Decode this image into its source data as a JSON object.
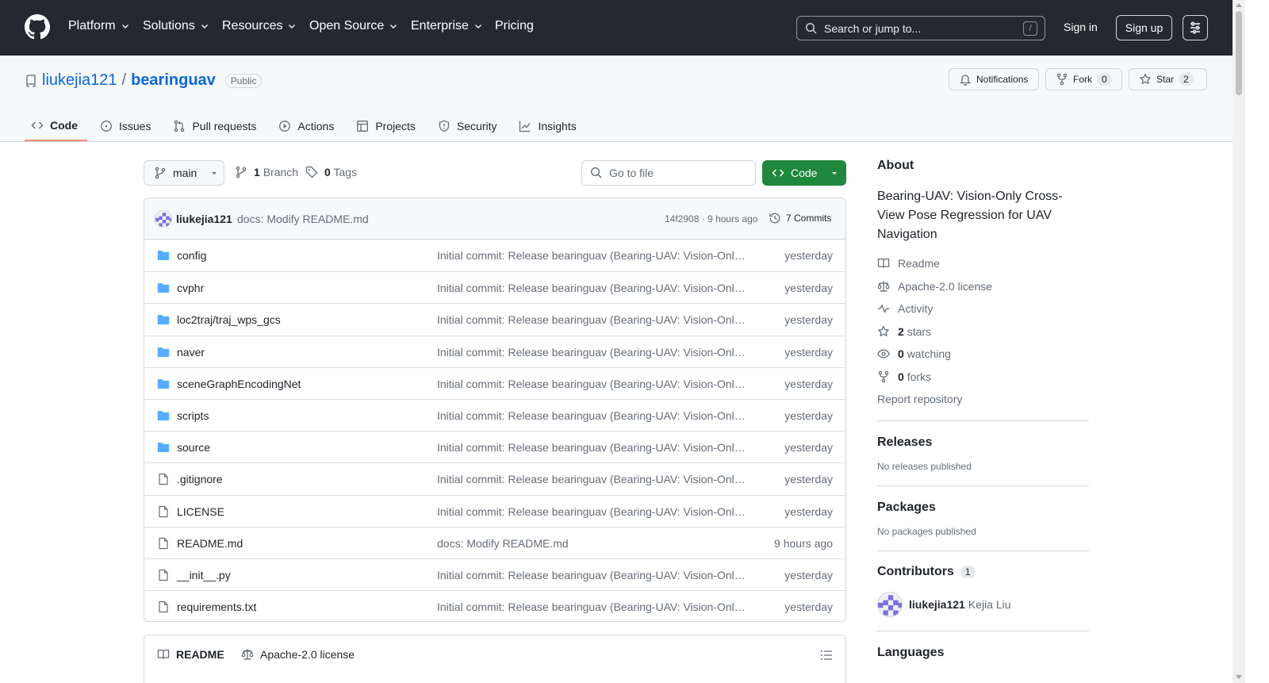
{
  "header": {
    "nav": [
      {
        "label": "Platform",
        "has_menu": true
      },
      {
        "label": "Solutions",
        "has_menu": true
      },
      {
        "label": "Resources",
        "has_menu": true
      },
      {
        "label": "Open Source",
        "has_menu": true
      },
      {
        "label": "Enterprise",
        "has_menu": true
      },
      {
        "label": "Pricing",
        "has_menu": false
      }
    ],
    "search_placeholder": "Search or jump to...",
    "search_shortcut": "/",
    "sign_in": "Sign in",
    "sign_up": "Sign up"
  },
  "repo": {
    "owner": "liukejia121",
    "separator": "/",
    "name": "bearinguav",
    "visibility": "Public",
    "notifications_label": "Notifications",
    "fork_label": "Fork",
    "fork_count": "0",
    "star_label": "Star",
    "star_count": "2",
    "tabs": [
      {
        "label": "Code",
        "icon": "code-icon",
        "active": true
      },
      {
        "label": "Issues",
        "icon": "issue-opened-icon",
        "active": false
      },
      {
        "label": "Pull requests",
        "icon": "git-pull-request-icon",
        "active": false
      },
      {
        "label": "Actions",
        "icon": "play-icon",
        "active": false
      },
      {
        "label": "Projects",
        "icon": "table-icon",
        "active": false
      },
      {
        "label": "Security",
        "icon": "shield-icon",
        "active": false
      },
      {
        "label": "Insights",
        "icon": "graph-icon",
        "active": false
      }
    ]
  },
  "toolbar": {
    "branch": "main",
    "branch_count": "1",
    "branch_label": "Branch",
    "tag_count": "0",
    "tag_label": "Tags",
    "goto_placeholder": "Go to file",
    "code_label": "Code"
  },
  "commit": {
    "author": "liukejia121",
    "message": "docs: Modify README.md",
    "hash": "14f2908",
    "dot": "·",
    "time": "9 hours ago",
    "commits_label": "7 Commits"
  },
  "files": [
    {
      "name": "config",
      "type": "dir",
      "message": "Initial commit: Release bearinguav (Bearing-UAV: Vision-Only Cross-View Pose Regression for UAV Navigation)",
      "time": "yesterday"
    },
    {
      "name": "cvphr",
      "type": "dir",
      "message": "Initial commit: Release bearinguav (Bearing-UAV: Vision-Only Cross-View Pose Regression for UAV Navigation)",
      "time": "yesterday"
    },
    {
      "name": "loc2traj/traj_wps_gcs",
      "type": "dir",
      "message": "Initial commit: Release bearinguav (Bearing-UAV: Vision-Only Cross-View Pose Regression for UAV Navigation)",
      "time": "yesterday"
    },
    {
      "name": "naver",
      "type": "dir",
      "message": "Initial commit: Release bearinguav (Bearing-UAV: Vision-Only Cross-View Pose Regression for UAV Navigation)",
      "time": "yesterday"
    },
    {
      "name": "sceneGraphEncodingNet",
      "type": "dir",
      "message": "Initial commit: Release bearinguav (Bearing-UAV: Vision-Only Cross-View Pose Regression for UAV Navigation)",
      "time": "yesterday"
    },
    {
      "name": "scripts",
      "type": "dir",
      "message": "Initial commit: Release bearinguav (Bearing-UAV: Vision-Only Cross-View Pose Regression for UAV Navigation)",
      "time": "yesterday"
    },
    {
      "name": "source",
      "type": "dir",
      "message": "Initial commit: Release bearinguav (Bearing-UAV: Vision-Only Cross-View Pose Regression for UAV Navigation)",
      "time": "yesterday"
    },
    {
      "name": ".gitignore",
      "type": "file",
      "message": "Initial commit: Release bearinguav (Bearing-UAV: Vision-Only Cross-View Pose Regression for UAV Navigation)",
      "time": "yesterday"
    },
    {
      "name": "LICENSE",
      "type": "file",
      "message": "Initial commit: Release bearinguav (Bearing-UAV: Vision-Only Cross-View Pose Regression for UAV Navigation)",
      "time": "yesterday"
    },
    {
      "name": "README.md",
      "type": "file",
      "message": "docs: Modify README.md",
      "time": "9 hours ago"
    },
    {
      "name": "__init__.py",
      "type": "file",
      "message": "Initial commit: Release bearinguav (Bearing-UAV: Vision-Only Cross-View Pose Regression for UAV Navigation)",
      "time": "yesterday"
    },
    {
      "name": "requirements.txt",
      "type": "file",
      "message": "Initial commit: Release bearinguav (Bearing-UAV: Vision-Only Cross-View Pose Regression for UAV Navigation)",
      "time": "yesterday"
    }
  ],
  "readme_tabs": {
    "readme": "README",
    "license": "Apache-2.0 license"
  },
  "about": {
    "title": "About",
    "description": "Bearing-UAV: Vision-Only Cross-View Pose Regression for UAV Navigation",
    "readme": "Readme",
    "license": "Apache-2.0 license",
    "activity": "Activity",
    "stars_count": "2",
    "stars_label": "stars",
    "watching_count": "0",
    "watching_label": "watching",
    "forks_count": "0",
    "forks_label": "forks",
    "report": "Report repository"
  },
  "releases": {
    "title": "Releases",
    "empty": "No releases published"
  },
  "packages": {
    "title": "Packages",
    "empty": "No packages published"
  },
  "contributors": {
    "title": "Contributors",
    "count": "1",
    "login": "liukejia121",
    "name": "Kejia Liu"
  },
  "languages": {
    "title": "Languages"
  },
  "colors": {
    "header_bg": "#24292f",
    "link": "#0969da",
    "code_button": "#1f883d",
    "folder": "#54aeff",
    "active_tab": "#fd8c73"
  }
}
